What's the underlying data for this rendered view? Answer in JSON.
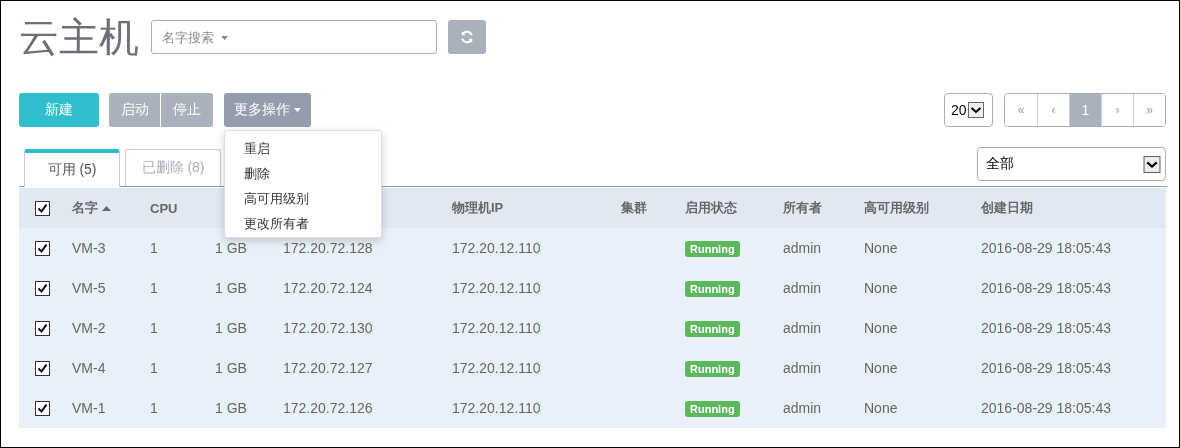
{
  "title": "云主机",
  "search": {
    "placeholder": "名字搜索"
  },
  "actions": {
    "create": "新建",
    "group": [
      "启动",
      "停止"
    ],
    "more": "更多操作"
  },
  "menu": [
    "重启",
    "删除",
    "高可用级别",
    "更改所有者"
  ],
  "page_size": "20",
  "pagination": [
    {
      "label": "«",
      "selected": false
    },
    {
      "label": "‹",
      "selected": false
    },
    {
      "label": "1",
      "selected": true
    },
    {
      "label": "›",
      "selected": false
    },
    {
      "label": "»",
      "selected": false
    }
  ],
  "tabs": [
    {
      "label": "可用 (5)",
      "selected": true
    },
    {
      "label": "已删除 (8)",
      "selected": false
    }
  ],
  "filter": "全部",
  "table": {
    "all_checked": true,
    "columns": [
      {
        "label": "名字",
        "sorted": true
      },
      {
        "label": "CPU",
        "sorted": false
      },
      {
        "sorted": false
      },
      {
        "sorted": false
      },
      {
        "label": "物理机IP",
        "sorted": false
      },
      {
        "label": "集群",
        "sorted": false
      },
      {
        "label": "启用状态",
        "sorted": false
      },
      {
        "label": "所有者",
        "sorted": false
      },
      {
        "label": "高可用级别",
        "sorted": false
      },
      {
        "label": "创建日期",
        "sorted": false
      }
    ],
    "rows": [
      {
        "checked": true,
        "cells": [
          "VM-3",
          "1",
          "1 GB",
          "172.20.72.128",
          "172.20.12.110",
          "",
          "Running",
          "admin",
          "None",
          "2016-08-29 18:05:43"
        ]
      },
      {
        "checked": true,
        "cells": [
          "VM-5",
          "1",
          "1 GB",
          "172.20.72.124",
          "172.20.12.110",
          "",
          "Running",
          "admin",
          "None",
          "2016-08-29 18:05:43"
        ]
      },
      {
        "checked": true,
        "cells": [
          "VM-2",
          "1",
          "1 GB",
          "172.20.72.130",
          "172.20.12.110",
          "",
          "Running",
          "admin",
          "None",
          "2016-08-29 18:05:43"
        ]
      },
      {
        "checked": true,
        "cells": [
          "VM-4",
          "1",
          "1 GB",
          "172.20.72.127",
          "172.20.12.110",
          "",
          "Running",
          "admin",
          "None",
          "2016-08-29 18:05:43"
        ]
      },
      {
        "checked": true,
        "cells": [
          "VM-1",
          "1",
          "1 GB",
          "172.20.72.126",
          "172.20.12.110",
          "",
          "Running",
          "admin",
          "None",
          "2016-08-29 18:05:43"
        ]
      }
    ]
  }
}
